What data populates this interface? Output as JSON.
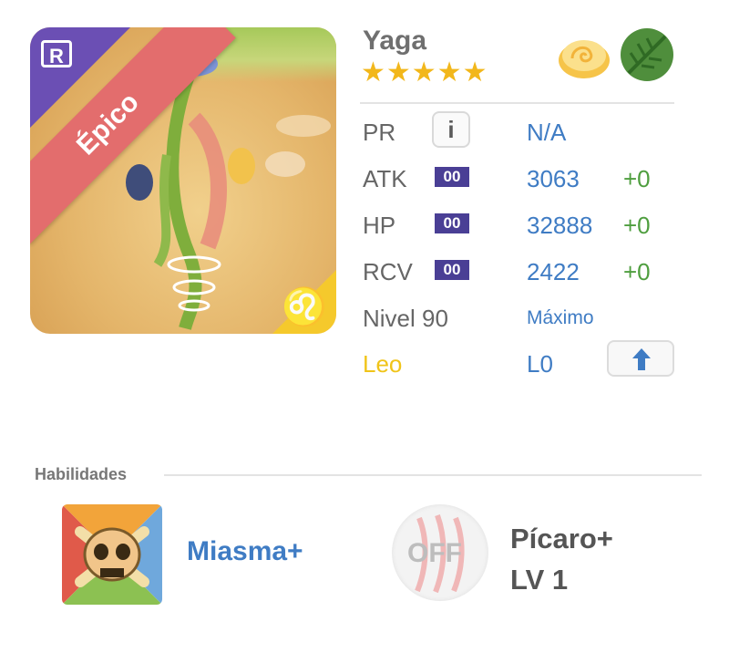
{
  "monster": {
    "name": "Yaga",
    "stars": "★★★★★",
    "rarity": "Épico",
    "rarity_badge": "R",
    "zodiac_symbol": "♌"
  },
  "stats": {
    "pr": {
      "label": "PR",
      "value": "N/A"
    },
    "atk": {
      "label": "ATK",
      "plus_badge": "00",
      "value": "3063",
      "bonus": "+0"
    },
    "hp": {
      "label": "HP",
      "plus_badge": "00",
      "value": "32888",
      "bonus": "+0"
    },
    "rcv": {
      "label": "RCV",
      "plus_badge": "00",
      "value": "2422",
      "bonus": "+0"
    },
    "level": {
      "label": "Nivel 90",
      "value": "Máximo"
    },
    "zodiac": {
      "label": "Leo",
      "value": "L0"
    }
  },
  "abilities": {
    "section_title": "Habilidades",
    "active": {
      "name": "Miasma+"
    },
    "awakening": {
      "state": "OFF",
      "name": "Pícaro+",
      "level": "LV 1"
    }
  },
  "colors": {
    "accent_blue": "#3f7cc4",
    "bonus_green": "#4f9e3f",
    "zodiac_yellow": "#f0c419",
    "star_gold": "#f2b71b",
    "rarity_red": "#e36d6d",
    "badge_purple": "#4a3f95"
  },
  "icons": {
    "element_1": "cloud-icon",
    "element_2": "leaf-icon",
    "info": "info-icon",
    "upgrade": "arrow-up-icon"
  }
}
